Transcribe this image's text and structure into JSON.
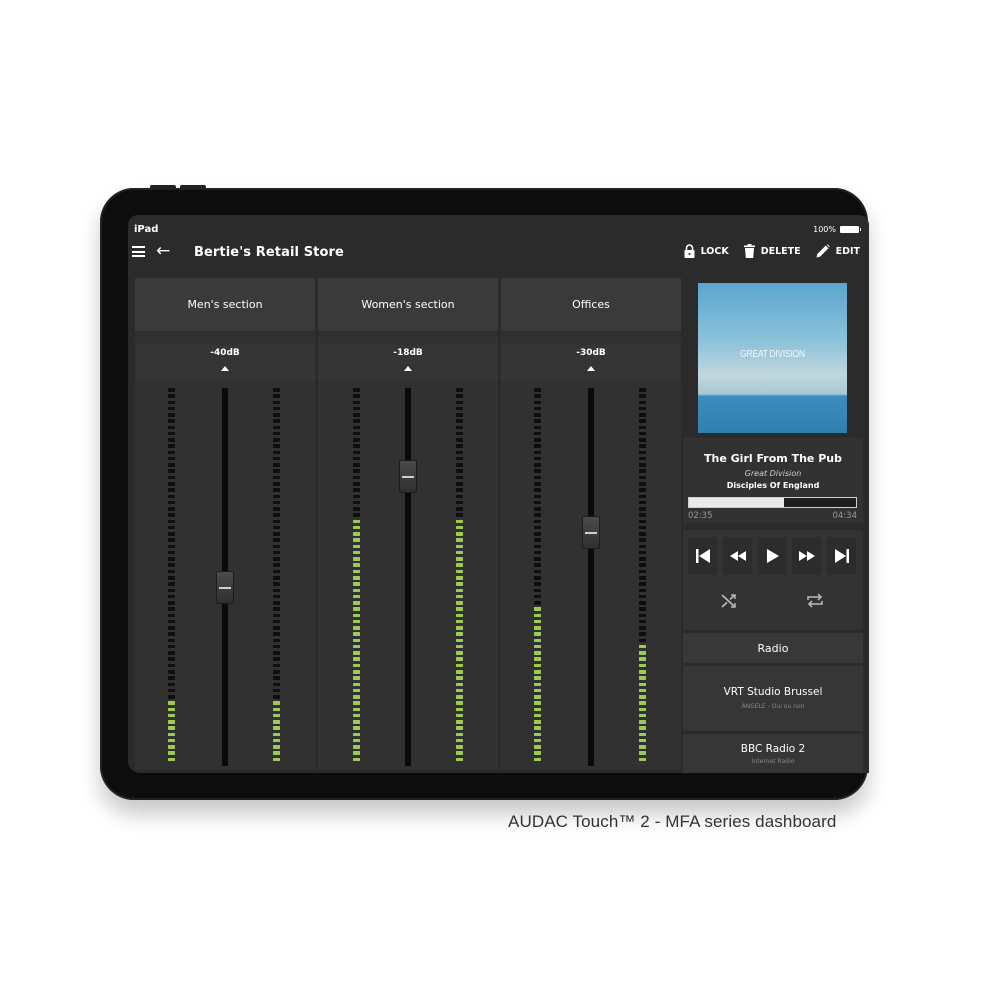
{
  "status": {
    "device": "iPad",
    "battery": "100%"
  },
  "toolbar": {
    "title": "Bertie's Retail Store",
    "lock_label": "LOCK",
    "delete_label": "DELETE",
    "edit_label": "EDIT"
  },
  "zones": [
    {
      "name": "Men's section",
      "gain": "-40dB",
      "fader_pct": 0.47,
      "meter_left": 0.17,
      "meter_right": 0.17
    },
    {
      "name": "Women's section",
      "gain": "-18dB",
      "fader_pct": 0.79,
      "meter_left": 0.65,
      "meter_right": 0.65
    },
    {
      "name": "Offices",
      "gain": "-30dB",
      "fader_pct": 0.63,
      "meter_left": 0.41,
      "meter_right": 0.31
    }
  ],
  "player": {
    "album_art_text": "GREAT DIVISION",
    "song": "The Girl From The Pub",
    "artist": "Great Division",
    "album": "Disciples Of England",
    "elapsed": "02:35",
    "duration": "04:34",
    "progress": 0.566
  },
  "transport": {
    "icons": [
      "skip-previous-icon",
      "rewind-icon",
      "play-icon",
      "fast-forward-icon",
      "skip-next-icon"
    ],
    "modes": [
      "shuffle-icon",
      "repeat-icon"
    ]
  },
  "radio": {
    "header": "Radio",
    "stations": [
      {
        "name": "VRT Studio Brussel",
        "subtitle": "ANGELE - Oui ou non"
      },
      {
        "name": "BBC Radio 2",
        "subtitle": "Internet Radio"
      }
    ]
  },
  "caption": "AUDAC Touch™ 2 - MFA series dashboard"
}
